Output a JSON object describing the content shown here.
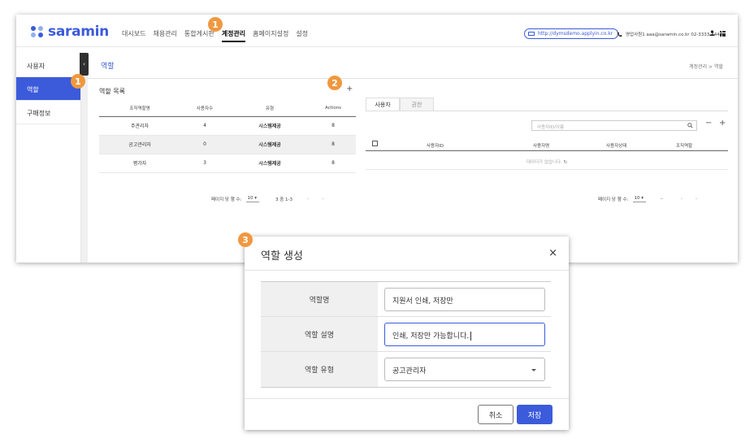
{
  "brand": {
    "name": "saramin",
    "dot_colors": [
      "#3b5bdb",
      "#8fb0f0",
      "#8fb0f0",
      "#3b5bdb"
    ]
  },
  "menu": [
    "대시보드",
    "채용관리",
    "통합게시판",
    "계정관리",
    "홈페이지설정",
    "설정"
  ],
  "active_menu": "계정관리",
  "header": {
    "url": "http://dymsdemo.applyin.co.kr",
    "contact": "영업사원1 aaa@saramin.co.kr 02-3333-4444"
  },
  "sidebar": {
    "items": [
      {
        "label": "사용자"
      },
      {
        "label": "역할"
      },
      {
        "label": "구매정보"
      }
    ],
    "toggle": "‹"
  },
  "content": {
    "title": "역할",
    "breadcrumb": "계정관리  >  역할"
  },
  "role_list": {
    "title": "역할 목록",
    "add": "+",
    "columns": [
      "조직역할명",
      "사용자수",
      "유형",
      "Actions"
    ],
    "rows": [
      {
        "name": "주관리자",
        "count": "4",
        "type": "시스템제공",
        "action": "8"
      },
      {
        "name": "공고관리자",
        "count": "0",
        "type": "시스템제공",
        "action": "8"
      },
      {
        "name": "평가자",
        "count": "3",
        "type": "시스템제공",
        "action": "8"
      }
    ],
    "pager": {
      "label": "페이지 당 행 수:",
      "value": "10",
      "range": "3 중 1-3",
      "prev": "‹",
      "next": "›"
    }
  },
  "user_panel": {
    "tabs": [
      "사용자",
      "권한"
    ],
    "search_placeholder": "사용자ID/이름",
    "minus": "−",
    "plus": "+",
    "columns": [
      "사용자ID",
      "사용자명",
      "사용자상태",
      "조직역할"
    ],
    "empty": "데이터가 없습니다.",
    "pager": {
      "label": "페이지 당 행 수:",
      "value": "10",
      "range": "–",
      "prev": "‹",
      "next": "›"
    }
  },
  "badges": [
    "1",
    "1",
    "2",
    "3"
  ],
  "modal": {
    "title": "역할 생성",
    "close": "×",
    "fields": [
      {
        "label": "역할명",
        "value": "지원서 인쇄, 저장만"
      },
      {
        "label": "역할 설명",
        "value": "인쇄, 저장만 가능합니다."
      },
      {
        "label": "역할 유형",
        "value": "공고관리자"
      }
    ],
    "cancel": "취소",
    "save": "저장"
  },
  "colors": {
    "accent": "#3b5bdb",
    "badge": "#f0983f"
  }
}
